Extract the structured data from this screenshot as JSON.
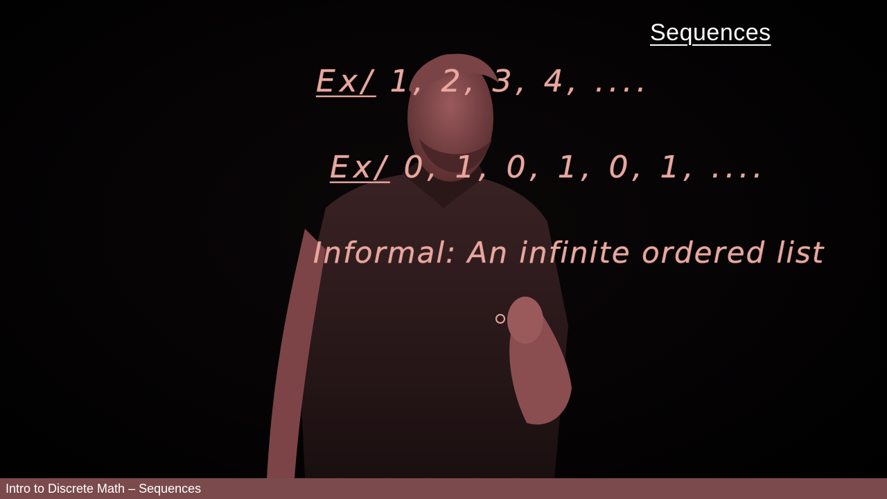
{
  "slide": {
    "title": "Sequences"
  },
  "handwriting": {
    "example1": {
      "tag": "Ex/",
      "text": "1, 2, 3, 4, ...."
    },
    "example2": {
      "tag": "Ex/",
      "text": "0, 1, 0, 1, 0, 1, ...."
    },
    "informal": {
      "label": "Informal:",
      "text": "An infinite ordered list"
    }
  },
  "footer": {
    "text": "Intro to Discrete Math – Sequences"
  },
  "colors": {
    "ink": "#e9a79e",
    "presenter": "#6e3a3c",
    "footer_bar": "#7a4a4c",
    "background": "#000000"
  }
}
